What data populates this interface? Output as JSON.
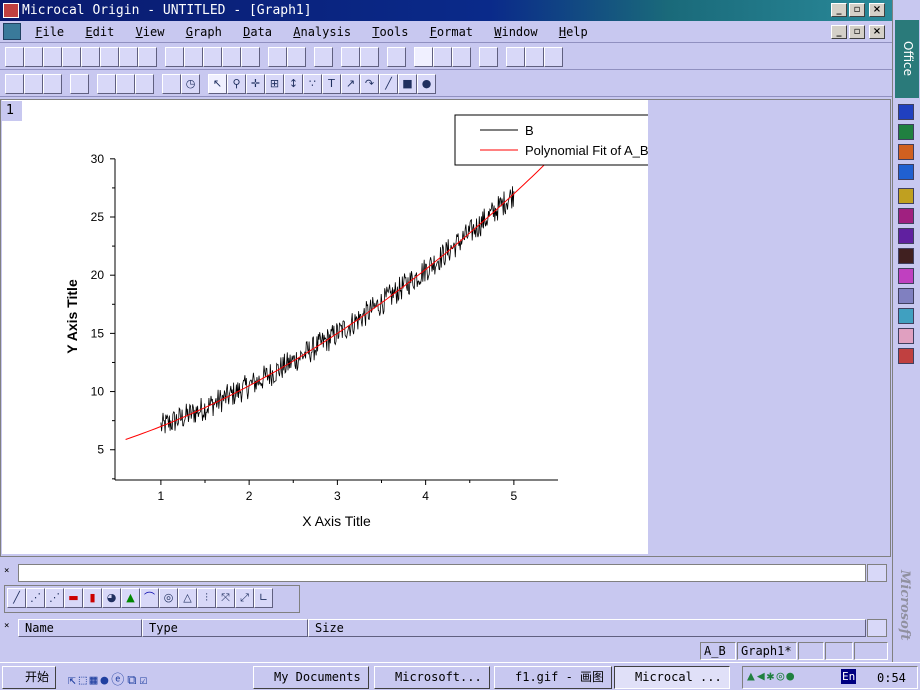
{
  "window": {
    "title": "Microcal Origin - UNTITLED - [Graph1]",
    "min": "_",
    "restore": "▫",
    "close": "×"
  },
  "menu": [
    "File",
    "Edit",
    "View",
    "Graph",
    "Data",
    "Analysis",
    "Tools",
    "Format",
    "Window",
    "Help"
  ],
  "layer_label": "1",
  "chart_data": {
    "type": "line",
    "xlabel": "X Axis Title",
    "ylabel": "Y Axis Title",
    "xlim": [
      0.48,
      5.5
    ],
    "ylim": [
      2.4,
      30.5
    ],
    "xticks": [
      "1",
      "2",
      "3",
      "4",
      "5"
    ],
    "yticks": [
      "5",
      "10",
      "15",
      "20",
      "25",
      "30"
    ],
    "grid": false,
    "legend": "top-right",
    "series": [
      {
        "name": "B",
        "color": "#000000",
        "style": "noisy data",
        "x_range": [
          1,
          5
        ]
      },
      {
        "name": "Polynomial Fit of A_B",
        "color": "#ff0000",
        "coefficients": [
          4.5,
          2.0,
          0.5
        ],
        "x_range": [
          0.6,
          5.45
        ]
      }
    ]
  },
  "project_explorer": {
    "columns": [
      "Name",
      "Type",
      "Size"
    ]
  },
  "status": {
    "cells": [
      "A_B",
      "Graph1*"
    ]
  },
  "office": {
    "label": "Office",
    "brand": "Microsoft"
  },
  "taskbar": {
    "start": "开始",
    "tasks": [
      "My Documents",
      "Microsoft...",
      "f1.gif - 画图",
      "Microcal ..."
    ],
    "tray_lang": "En",
    "clock": "0:54"
  }
}
